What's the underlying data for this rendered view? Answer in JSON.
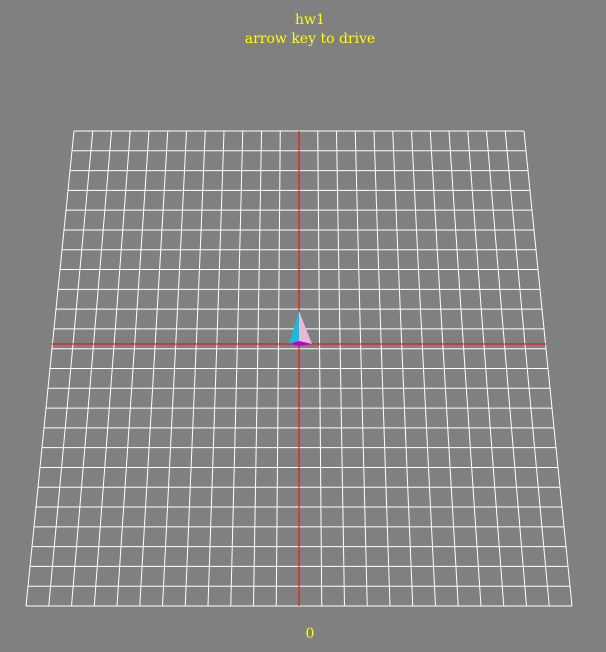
{
  "hud": {
    "title": "hw1",
    "instruction": "arrow key to drive",
    "score": "0"
  },
  "scene": {
    "background_color": "#808080",
    "grid_color": "#ffffff",
    "axis_color": "#ff0000",
    "player_colors": {
      "left_face": "#20b8d8",
      "right_face": "#e8b8d8",
      "base": "#c000c0"
    }
  }
}
